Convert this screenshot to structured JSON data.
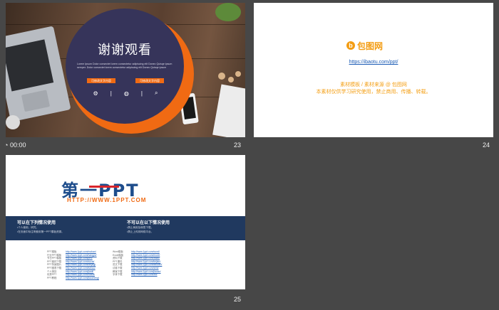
{
  "slides": [
    {
      "number": "23",
      "title": "谢谢观看",
      "lorem": "Lorem Ipsum Dolor consectet lorem consectetur adipiscing elit Donec Quisqe ipsum semper. Dolor consectet lorem consectetur adipiscing elit Donec Quisqe ipsum",
      "buttons": [
        "可修改文字内容",
        "可修改文字内容"
      ],
      "icons": [
        "gear-icon",
        "globe-icon",
        "search-icon"
      ],
      "timer": "00:00"
    },
    {
      "number": "24",
      "logo_text": "包图网",
      "url": "https://ibaotu.com/ppt/",
      "line1": "素材模板 / 素材来源 @ 包图网",
      "line2": "本素材仅供学习研究使用，禁止商用、传播、转载。"
    },
    {
      "number": "25",
      "headline": "第一PPT",
      "url": "HTTP://WWW.1PPT.COM",
      "left_heading": "可以在下列情况使用",
      "left_lines": [
        "•个人使用，研究。",
        "•在页面中标注明使用第一PPT模板资源。"
      ],
      "right_heading": "不可以在以下情况使用",
      "right_lines": [
        "•禁止商用及转售下载。",
        "•禁止上传到网络平台。"
      ],
      "links_left": [
        {
          "k": "PPT模板",
          "v": "http://www.1ppt.com/moban/"
        },
        {
          "k": "行业PPT模板",
          "v": "http://www.1ppt.com/hangye/"
        },
        {
          "k": "节日PPT模板",
          "v": "http://www.1ppt.com/jieri/"
        },
        {
          "k": "PPT素材下载",
          "v": "http://www.1ppt.com/sucai/"
        },
        {
          "k": "PPT背景图片",
          "v": "http://www.1ppt.com/beijing/"
        },
        {
          "k": "PPT图表下载",
          "v": "http://www.1ppt.com/tubiao/"
        },
        {
          "k": "个人简历",
          "v": "http://www.1ppt.com/jianli/"
        },
        {
          "k": "优秀PPT",
          "v": "http://www.1ppt.com/xiazai/"
        },
        {
          "k": "PPT教程",
          "v": "http://www.1ppt.com/jiaocheng/"
        }
      ],
      "links_right": [
        {
          "k": "Word模板",
          "v": "http://www.1ppt.com/word/"
        },
        {
          "k": "Excel模板",
          "v": "http://www.1ppt.com/excel/"
        },
        {
          "k": "资料下载",
          "v": "http://www.1ppt.com/ziliao/"
        },
        {
          "k": "PPT课件",
          "v": "http://www.1ppt.com/kejian/"
        },
        {
          "k": "范文下载",
          "v": "http://www.1ppt.com/fanwen/"
        },
        {
          "k": "试卷下载",
          "v": "http://www.1ppt.com/shiti/"
        },
        {
          "k": "教案下载",
          "v": "http://www.1ppt.com/jiaoan/"
        },
        {
          "k": "字体下载",
          "v": "http://www.1ppt.com/ziti/"
        }
      ]
    }
  ]
}
